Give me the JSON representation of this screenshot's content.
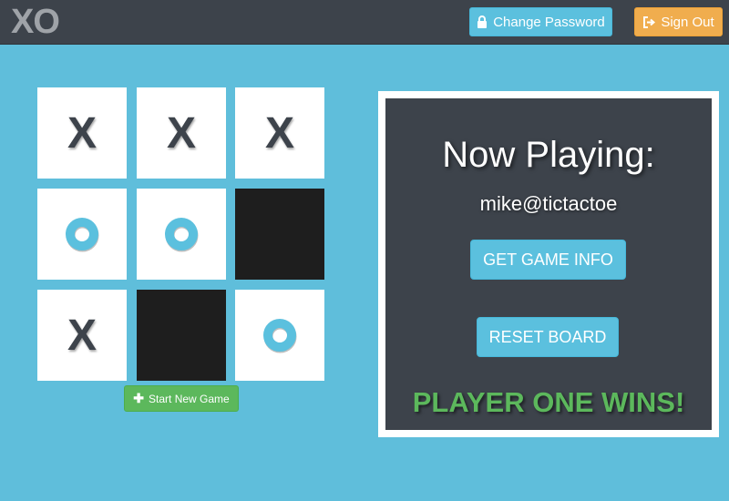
{
  "app": {
    "logo": "XO"
  },
  "navbar": {
    "change_password_label": "Change Password",
    "change_password_icon": "lock-icon",
    "sign_out_label": "Sign Out",
    "sign_out_icon": "sign-out-icon"
  },
  "board": {
    "cells": [
      "X",
      "X",
      "X",
      "O",
      "O",
      "",
      "X",
      "",
      "O"
    ],
    "filled_dark_cells": [
      5,
      7
    ]
  },
  "start_button": {
    "label": "Start New Game",
    "icon": "plus-icon"
  },
  "panel": {
    "heading": "Now Playing:",
    "player": "mike@tictactoe",
    "game_info_label": "GET GAME INFO",
    "reset_label": "RESET BOARD",
    "result": "PLAYER ONE WINS!"
  },
  "colors": {
    "background": "#5fbedb",
    "navbar": "#3d434b",
    "panel": "#3d434b",
    "info_button": "#5bc0de",
    "warning_button": "#f0ad4e",
    "success": "#5cb85c",
    "o_mark": "#5bc0de",
    "x_mark": "#3d434b"
  }
}
